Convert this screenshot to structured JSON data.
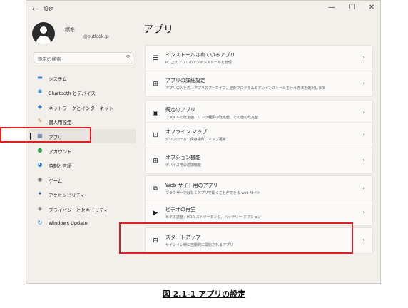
{
  "window": {
    "back_icon": "←",
    "title": "設定",
    "minimize": "—",
    "maximize": "☐",
    "close": "✕"
  },
  "profile": {
    "name": "標準",
    "email": "@outlook.jp"
  },
  "search": {
    "placeholder": "設定の検索",
    "icon": "⚲"
  },
  "sidebar": {
    "items": [
      {
        "label": "システム",
        "icon": "▬",
        "color": "#2a7bd1"
      },
      {
        "label": "Bluetooth とデバイス",
        "icon": "✱",
        "color": "#2a7bd1"
      },
      {
        "label": "ネットワークとインターネット",
        "icon": "◆",
        "color": "#2a7bd1"
      },
      {
        "label": "個人用設定",
        "icon": "✎",
        "color": "#c7782f"
      },
      {
        "label": "アプリ",
        "icon": "▦",
        "color": "#4a6a9a"
      },
      {
        "label": "アカウント",
        "icon": "●",
        "color": "#2aa24a"
      },
      {
        "label": "時刻と言語",
        "icon": "◕",
        "color": "#2a7bd1"
      },
      {
        "label": "ゲーム",
        "icon": "◉",
        "color": "#6b6b6b"
      },
      {
        "label": "アクセシビリティ",
        "icon": "✦",
        "color": "#1a5fa8"
      },
      {
        "label": "プライバシーとセキュリティ",
        "icon": "◈",
        "color": "#7a7a7a"
      },
      {
        "label": "Windows Update",
        "icon": "↻",
        "color": "#2a7bd1"
      }
    ]
  },
  "main": {
    "title": "アプリ",
    "cards": [
      {
        "icon": "☰",
        "title": "インストールされているアプリ",
        "desc": "PC 上のアプリのアンインストールと管理"
      },
      {
        "icon": "⊞",
        "title": "アプリの詳細設定",
        "desc": "アプリの入手先、アプリのアーカイブ、更新プログラムのアンインストールを行う方法を選択します"
      },
      {
        "icon": "▣",
        "title": "既定のアプリ",
        "desc": "ファイルの既定値、リンク種類の既定値、その他の既定値"
      },
      {
        "icon": "⊡",
        "title": "オフライン マップ",
        "desc": "ダウンロード、保存場所、マップ更新"
      },
      {
        "icon": "⊞",
        "title": "オプション機能",
        "desc": "デバイス用の追加機能"
      },
      {
        "icon": "⧉",
        "title": "Web サイト用のアプリ",
        "desc": "ブラウザーではなくアプリで開くことができる web サイト"
      },
      {
        "icon": "▶",
        "title": "ビデオの再生",
        "desc": "ビデオ調整、HDR ストリーミング、バッテリー オプション"
      },
      {
        "icon": "⊟",
        "title": "スタートアップ",
        "desc": "サインイン時に自動的に開始されるアプリ"
      }
    ],
    "chevron": "›"
  },
  "caption": "図 2.1-1 アプリの設定"
}
